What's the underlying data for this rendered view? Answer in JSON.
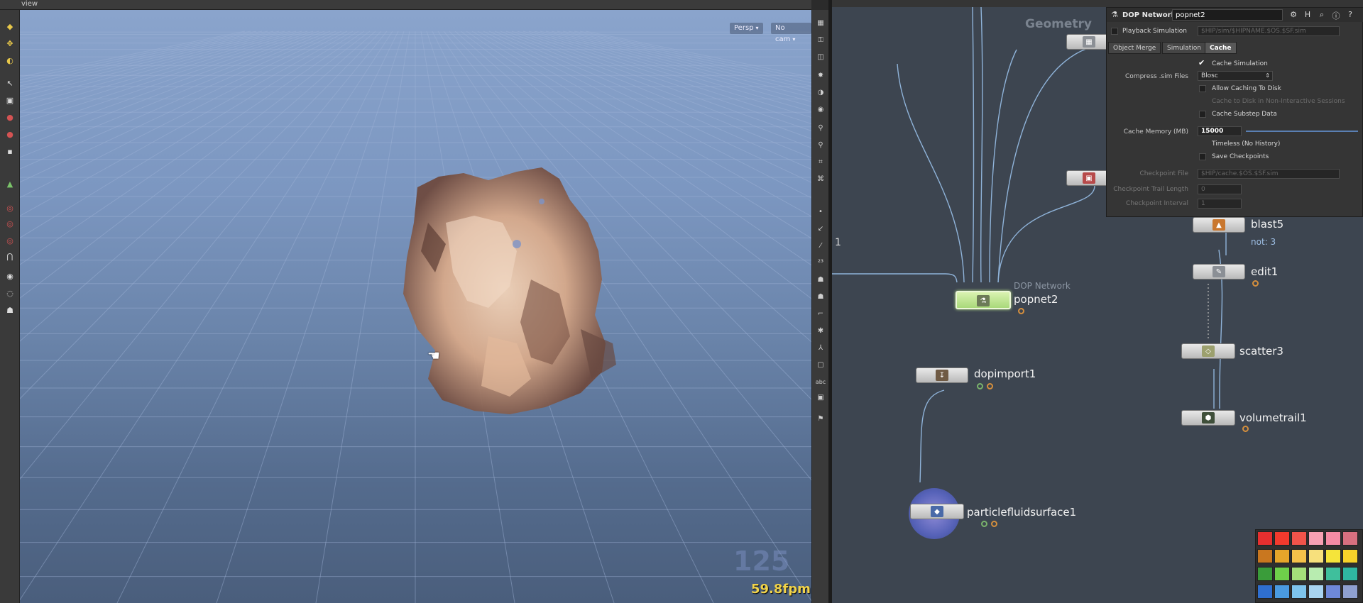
{
  "viewport": {
    "tab_label": "view",
    "camera_menu": "Persp",
    "cam_menu": "No cam",
    "fps": "59.8fpm",
    "overlay_number": "125"
  },
  "left_shelf": {
    "tools": [
      "select-icon",
      "transform-icon",
      "rotate-icon",
      "scale-icon",
      "handle-icon",
      "pose-icon",
      "brush-icon",
      "snap-icon",
      "magnet-icon",
      "camera-icon",
      "light-icon",
      "render-icon"
    ]
  },
  "right_strip": {
    "tools": [
      "display-options-icon",
      "lock-icon",
      "camera-view-icon",
      "light-link-icon",
      "shading-icon",
      "visibility-icon",
      "point-icon",
      "vertex-icon",
      "edge-icon",
      "primitive-icon",
      "normal-icon",
      "uv-icon",
      "grid-icon",
      "frame-icon",
      "abc-icon",
      "snapshot-icon"
    ],
    "abc_label": "abc"
  },
  "network": {
    "context_label": "Geometry",
    "index_label": "1",
    "nodes": {
      "popnet2": {
        "name": "popnet2",
        "type": "DOP Network"
      },
      "dopimport1": {
        "name": "dopimport1"
      },
      "particlefluidsurface1": {
        "name": "particlefluidsurface1"
      },
      "blast5": {
        "name": "blast5",
        "comment": "not: 3"
      },
      "edit1": {
        "name": "edit1"
      },
      "scatter3": {
        "name": "scatter3"
      },
      "volumetrail1": {
        "name": "volumetrail1"
      }
    }
  },
  "params": {
    "node_type": "DOP Network",
    "node_name": "popnet2",
    "playback_simulation": "Playback Simulation",
    "playback_path": "$HIP/sim/$HIPNAME.$OS.$SF.sim",
    "tabs": [
      "Object Merge",
      "Simulation",
      "Cache"
    ],
    "active_tab": "Cache",
    "cache_simulation": "Cache Simulation",
    "compress_label": "Compress .sim Files",
    "compress_value": "Blosc",
    "allow_caching_to_disk": "Allow Caching To Disk",
    "cache_non_interactive": "Cache to Disk in Non-Interactive Sessions",
    "cache_substep": "Cache Substep Data",
    "cache_memory_label": "Cache Memory (MB)",
    "cache_memory_value": "15000",
    "timeless": "Timeless (No History)",
    "save_checkpoints": "Save Checkpoints",
    "checkpoint_file_label": "Checkpoint File",
    "checkpoint_file_value": "$HIP/cache.$OS.$SF.sim",
    "checkpoint_trail_label": "Checkpoint Trail Length",
    "checkpoint_trail_value": "0",
    "checkpoint_interval_label": "Checkpoint Interval",
    "checkpoint_interval_value": "1"
  },
  "palette": {
    "colors": [
      "#e62f2f",
      "#f23a2d",
      "#f2544a",
      "#f7a0b2",
      "#f58ba4",
      "#d8707f",
      "#c9771f",
      "#e6a52a",
      "#f5c24a",
      "#f7e07c",
      "#f5e43a",
      "#f7d22a",
      "#3a9c3a",
      "#6ed04a",
      "#a4e07a",
      "#b8ecb0",
      "#3fbf9c",
      "#2fb7a2",
      "#2f6fd0",
      "#4a9ae0",
      "#7ec4ec",
      "#a8d4f0",
      "#6e88d8",
      "#8fa0d0"
    ]
  }
}
